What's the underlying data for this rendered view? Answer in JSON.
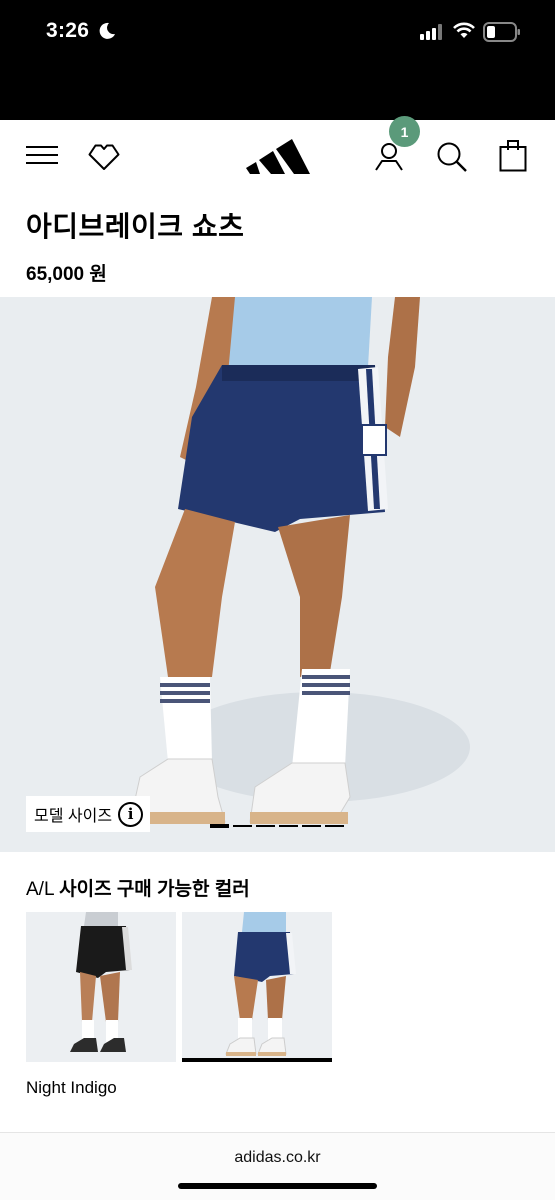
{
  "status_bar": {
    "time": "3:26"
  },
  "header": {
    "cart_badge_count": "1",
    "icons": [
      "menu-icon",
      "wishlist-heart-icon",
      "adidas-logo",
      "account-icon",
      "search-icon",
      "shopping-bag-icon"
    ]
  },
  "product": {
    "title": "아디브레이크 쇼츠",
    "price": "65,000 원"
  },
  "gallery": {
    "model_size_label": "모델 사이즈",
    "info_glyph": "i",
    "slide_count": 6,
    "active_slide": 1
  },
  "colors": {
    "title_prefix": "A/L",
    "title_main": "사이즈 구매 가능한 컬러",
    "options": [
      {
        "name": "Black",
        "selected": false
      },
      {
        "name": "Night Indigo",
        "selected": true
      }
    ],
    "selected_name": "Night Indigo"
  },
  "browser": {
    "url": "adidas.co.kr"
  },
  "colors_hex": {
    "badge": "#5b9a7a",
    "shorts_indigo": "#23386f",
    "background_image": "#e9edf0",
    "top_light_blue": "#a6cbe8"
  }
}
